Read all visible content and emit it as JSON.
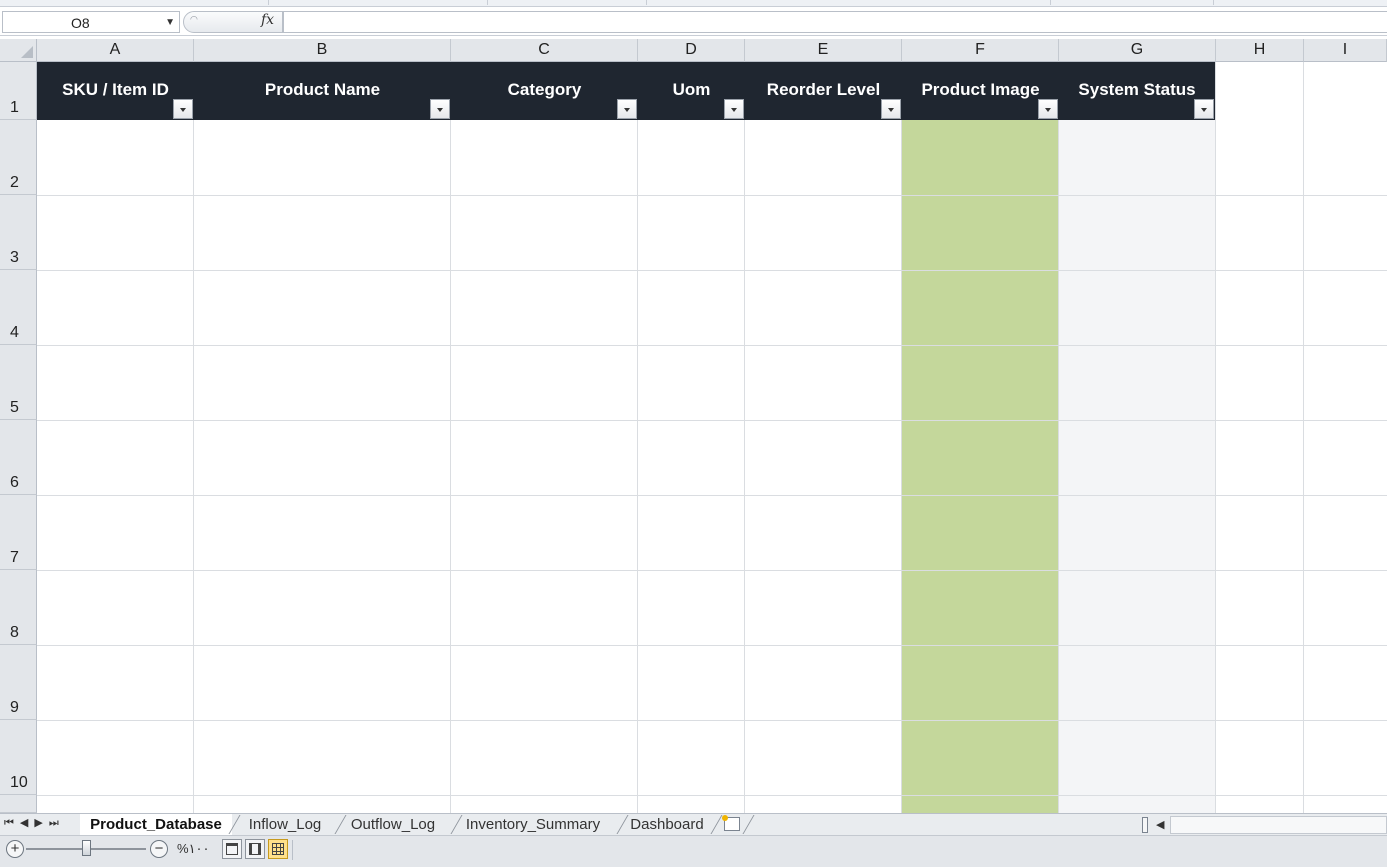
{
  "formula_bar": {
    "name_box": "O8",
    "fx_label": "fx",
    "formula": ""
  },
  "columns": [
    "A",
    "B",
    "C",
    "D",
    "E",
    "F",
    "G",
    "H",
    "I"
  ],
  "rows": [
    "1",
    "2",
    "3",
    "4",
    "5",
    "6",
    "7",
    "8",
    "9",
    "10"
  ],
  "table_headers": [
    "SKU / Item ID",
    "Product Name",
    "Category",
    "Uom",
    "Reorder Level",
    "Product Image",
    "System Status"
  ],
  "colors": {
    "header_fill": "#1f2630",
    "product_image_fill": "#c4d79b",
    "system_status_fill": "#f4f5f7"
  },
  "sheet_tabs": [
    "Product_Database",
    "Inflow_Log",
    "Outflow_Log",
    "Inventory_Summary",
    "Dashboard"
  ],
  "active_sheet": "Product_Database",
  "status_bar": {
    "zoom_level": "%١٠٠",
    "zoom_in": "+",
    "zoom_out": "−"
  }
}
